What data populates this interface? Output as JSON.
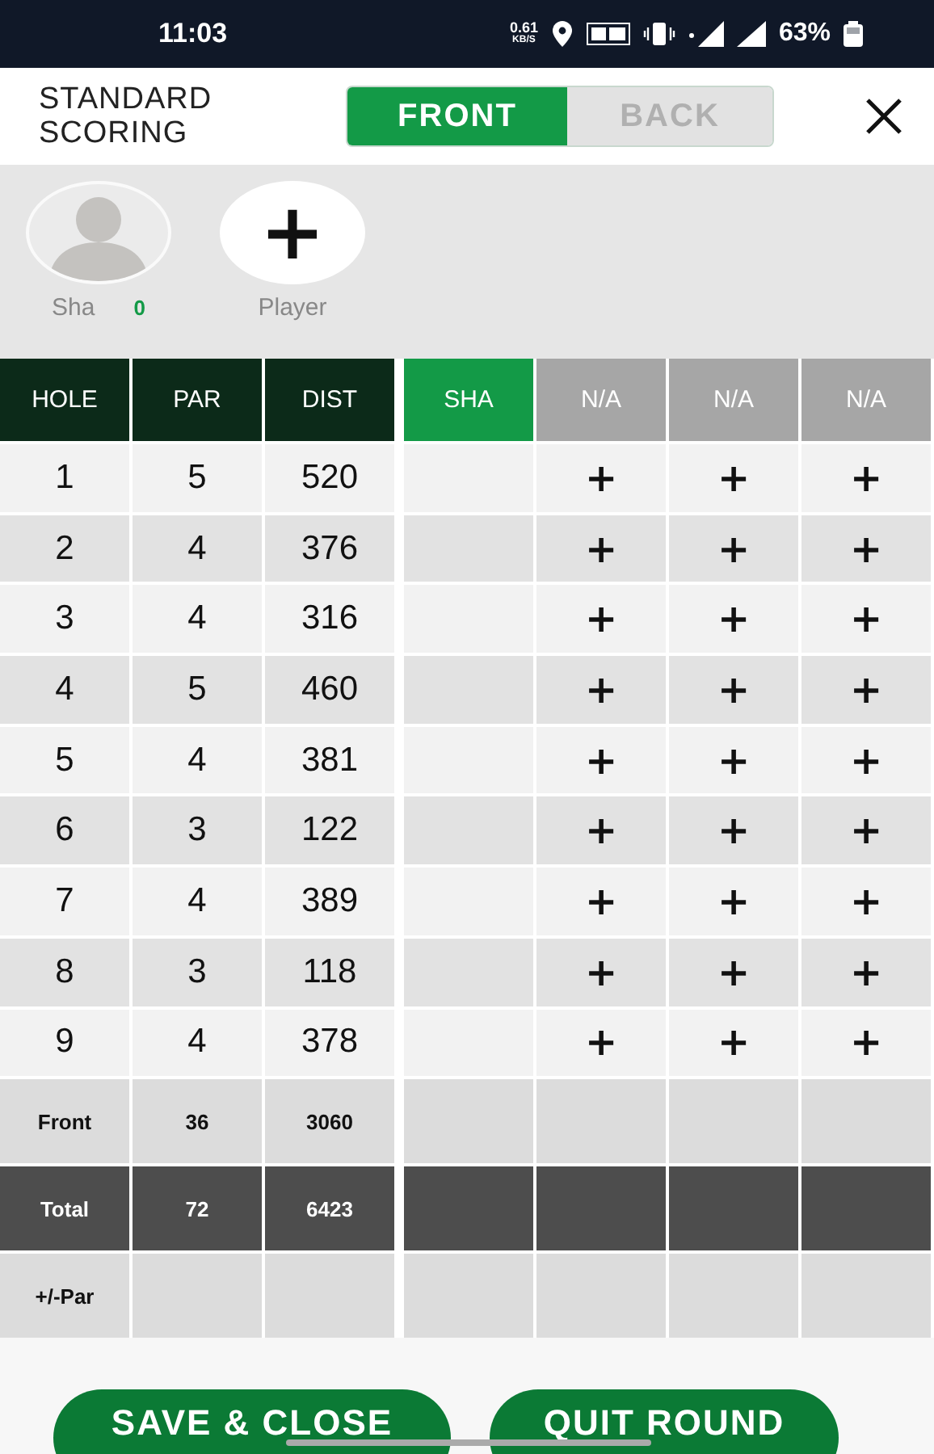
{
  "status_bar": {
    "time": "11:03",
    "speed": "0.61",
    "speed_unit": "KB/S",
    "battery": "63%"
  },
  "header": {
    "title": "STANDARD SCORING",
    "tabs": [
      {
        "label": "FRONT",
        "selected": true
      },
      {
        "label": "BACK",
        "selected": false
      }
    ]
  },
  "players": [
    {
      "kind": "player",
      "name": "Sha",
      "score": "0"
    },
    {
      "kind": "add",
      "glyph": "+",
      "name": "Player"
    }
  ],
  "table": {
    "columns": [
      "HOLE",
      "PAR",
      "DIST"
    ],
    "player_columns": [
      {
        "label": "SHA",
        "selected": true
      },
      {
        "label": "N/A",
        "selected": false
      },
      {
        "label": "N/A",
        "selected": false
      },
      {
        "label": "N/A",
        "selected": false
      }
    ],
    "rows": [
      {
        "hole": "1",
        "par": "5",
        "dist": "520",
        "cells": [
          {
            "kind": "score"
          },
          {
            "kind": "add",
            "label": "+"
          },
          {
            "kind": "add",
            "label": "+"
          },
          {
            "kind": "add",
            "label": "+"
          }
        ]
      },
      {
        "hole": "2",
        "par": "4",
        "dist": "376",
        "cells": [
          {
            "kind": "score"
          },
          {
            "kind": "add",
            "label": "+"
          },
          {
            "kind": "add",
            "label": "+"
          },
          {
            "kind": "add",
            "label": "+"
          }
        ]
      },
      {
        "hole": "3",
        "par": "4",
        "dist": "316",
        "cells": [
          {
            "kind": "score"
          },
          {
            "kind": "add",
            "label": "+"
          },
          {
            "kind": "add",
            "label": "+"
          },
          {
            "kind": "add",
            "label": "+"
          }
        ]
      },
      {
        "hole": "4",
        "par": "5",
        "dist": "460",
        "cells": [
          {
            "kind": "score"
          },
          {
            "kind": "add",
            "label": "+"
          },
          {
            "kind": "add",
            "label": "+"
          },
          {
            "kind": "add",
            "label": "+"
          }
        ]
      },
      {
        "hole": "5",
        "par": "4",
        "dist": "381",
        "cells": [
          {
            "kind": "score"
          },
          {
            "kind": "add",
            "label": "+"
          },
          {
            "kind": "add",
            "label": "+"
          },
          {
            "kind": "add",
            "label": "+"
          }
        ]
      },
      {
        "hole": "6",
        "par": "3",
        "dist": "122",
        "cells": [
          {
            "kind": "score"
          },
          {
            "kind": "add",
            "label": "+"
          },
          {
            "kind": "add",
            "label": "+"
          },
          {
            "kind": "add",
            "label": "+"
          }
        ]
      },
      {
        "hole": "7",
        "par": "4",
        "dist": "389",
        "cells": [
          {
            "kind": "score"
          },
          {
            "kind": "add",
            "label": "+"
          },
          {
            "kind": "add",
            "label": "+"
          },
          {
            "kind": "add",
            "label": "+"
          }
        ]
      },
      {
        "hole": "8",
        "par": "3",
        "dist": "118",
        "cells": [
          {
            "kind": "score"
          },
          {
            "kind": "add",
            "label": "+"
          },
          {
            "kind": "add",
            "label": "+"
          },
          {
            "kind": "add",
            "label": "+"
          }
        ]
      },
      {
        "hole": "9",
        "par": "4",
        "dist": "378",
        "cells": [
          {
            "kind": "score"
          },
          {
            "kind": "add",
            "label": "+"
          },
          {
            "kind": "add",
            "label": "+"
          },
          {
            "kind": "add",
            "label": "+"
          }
        ]
      }
    ],
    "summary": [
      {
        "kind": "front",
        "label": "Front",
        "par": "36",
        "dist": "3060"
      },
      {
        "kind": "total",
        "label": "Total",
        "par": "72",
        "dist": "6423"
      },
      {
        "kind": "front",
        "label": "+/-Par"
      }
    ]
  },
  "buttons": [
    "SAVE & CLOSE",
    "QUIT ROUND"
  ]
}
